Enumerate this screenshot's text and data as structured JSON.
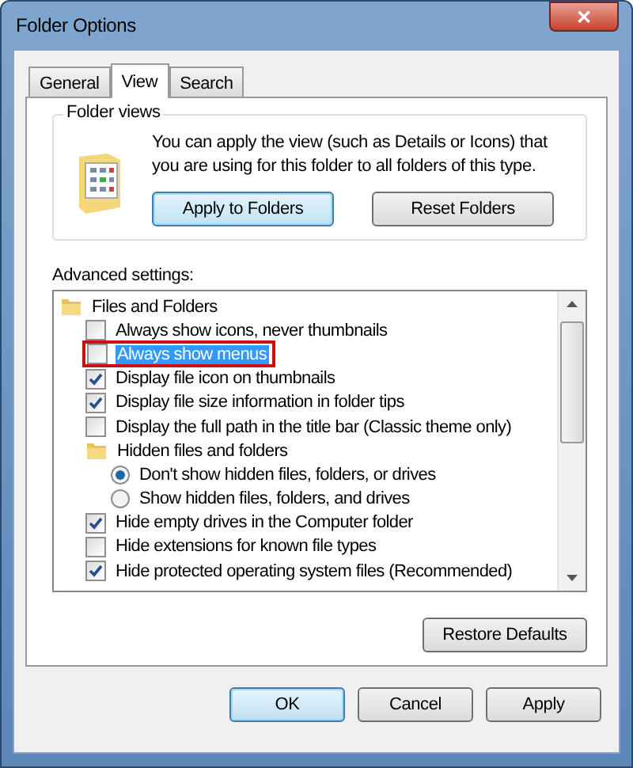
{
  "window": {
    "title": "Folder Options",
    "close": "✕"
  },
  "tabs": [
    {
      "label": "General",
      "selected": false
    },
    {
      "label": "View",
      "selected": true
    },
    {
      "label": "Search",
      "selected": false
    }
  ],
  "folder_views": {
    "title": "Folder views",
    "text": "You can apply the view (such as Details or Icons) that you are using for this folder to all folders of this type.",
    "buttons": [
      {
        "label": "Apply to Folders",
        "default": true
      },
      {
        "label": "Reset Folders",
        "default": false
      }
    ]
  },
  "advanced": {
    "label": "Advanced settings:",
    "items": [
      {
        "kind": "folder",
        "label": "Files and Folders",
        "selected": false,
        "children": [
          {
            "kind": "checkbox",
            "label": "Always show icons, never thumbnails",
            "checked": false,
            "selected": false
          },
          {
            "kind": "checkbox",
            "label": "Always show menus",
            "checked": false,
            "selected": true,
            "annotated": true
          },
          {
            "kind": "checkbox",
            "label": "Display file icon on thumbnails",
            "checked": true,
            "selected": false
          },
          {
            "kind": "checkbox",
            "label": "Display file size information in folder tips",
            "checked": true,
            "selected": false
          },
          {
            "kind": "checkbox",
            "label": "Display the full path in the title bar (Classic theme only)",
            "checked": false,
            "selected": false
          },
          {
            "kind": "folder",
            "label": "Hidden files and folders",
            "selected": false,
            "children": [
              {
                "kind": "radio",
                "label": "Don't show hidden files, folders, or drives",
                "checked": true,
                "selected": false
              },
              {
                "kind": "radio",
                "label": "Show hidden files, folders, and drives",
                "checked": false,
                "selected": false
              }
            ]
          },
          {
            "kind": "checkbox",
            "label": "Hide empty drives in the Computer folder",
            "checked": true,
            "selected": false
          },
          {
            "kind": "checkbox",
            "label": "Hide extensions for known file types",
            "checked": false,
            "selected": false
          },
          {
            "kind": "checkbox",
            "label": "Hide protected operating system files (Recommended)",
            "checked": true,
            "selected": false
          }
        ]
      }
    ],
    "restore": "Restore Defaults"
  },
  "buttons": [
    {
      "label": "OK",
      "default": true
    },
    {
      "label": "Cancel",
      "default": false
    },
    {
      "label": "Apply",
      "default": false
    }
  ]
}
